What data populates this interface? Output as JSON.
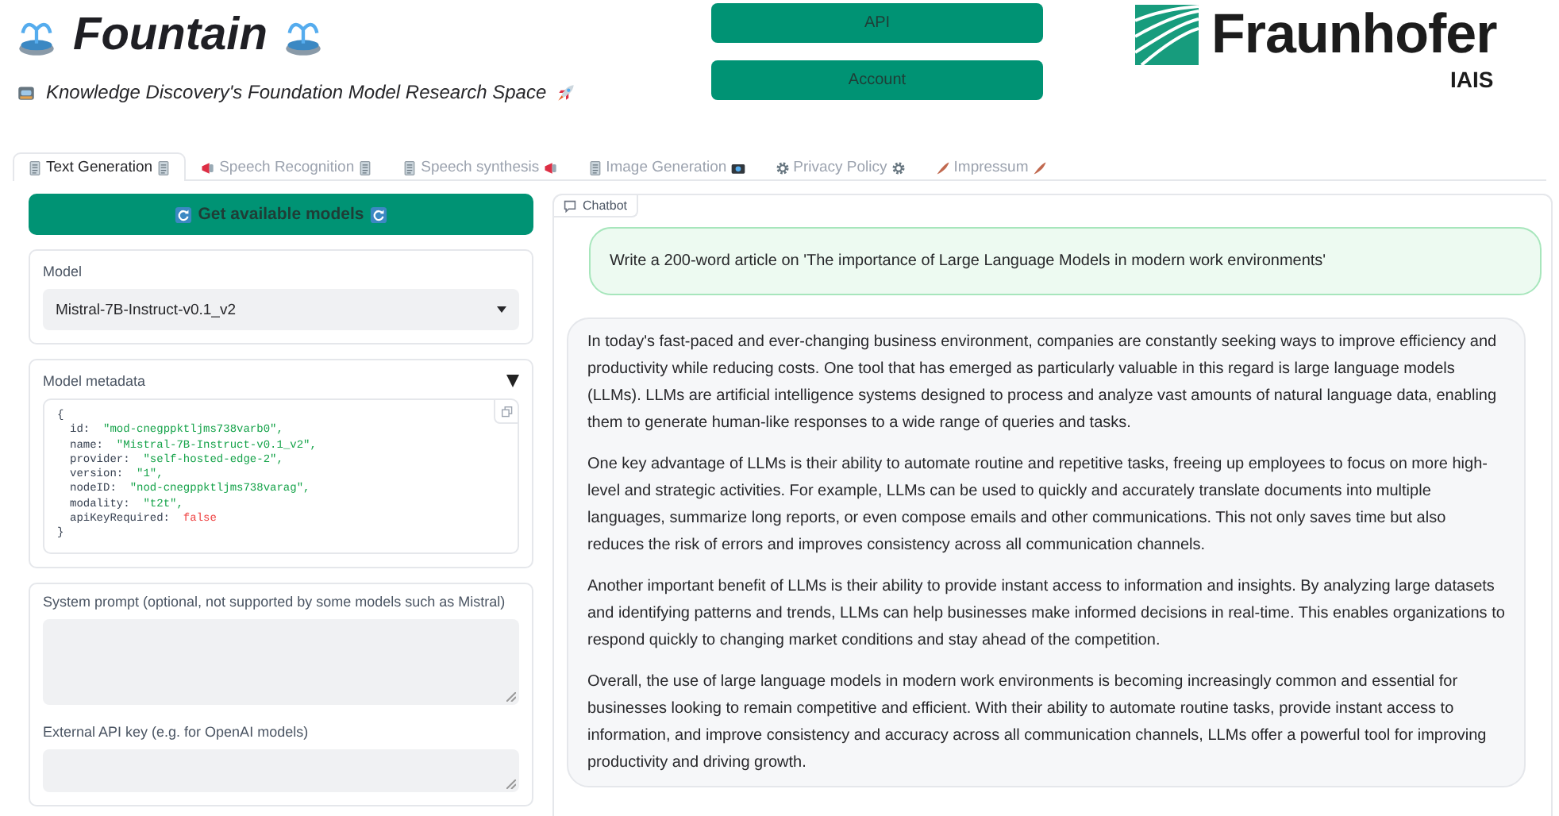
{
  "header": {
    "title": "Fountain",
    "subtitle": "Knowledge Discovery's Foundation Model Research Space",
    "buttons": [
      "API",
      "Account"
    ],
    "logo": {
      "name": "Fraunhofer",
      "sub": "IAIS"
    }
  },
  "tabs": [
    {
      "label": "Text Generation",
      "selected": true
    },
    {
      "label": "Speech Recognition",
      "selected": false
    },
    {
      "label": "Speech synthesis",
      "selected": false
    },
    {
      "label": "Image Generation",
      "selected": false
    },
    {
      "label": "Privacy Policy",
      "selected": false
    },
    {
      "label": "Impressum",
      "selected": false
    }
  ],
  "controls": {
    "get_models_button": "Get available models",
    "model": {
      "label": "Model",
      "value": "Mistral-7B-Instruct-v0.1_v2"
    },
    "metadata": {
      "label": "Model metadata",
      "expanded": true,
      "open": "{",
      "close": "}",
      "lines": [
        {
          "key": "id:",
          "value": "\"mod-cnegppktljms738varb0\",",
          "kind": "string"
        },
        {
          "key": "name:",
          "value": "\"Mistral-7B-Instruct-v0.1_v2\",",
          "kind": "string"
        },
        {
          "key": "provider:",
          "value": "\"self-hosted-edge-2\",",
          "kind": "string"
        },
        {
          "key": "version:",
          "value": "\"1\",",
          "kind": "string"
        },
        {
          "key": "nodeID:",
          "value": "\"nod-cnegppktljms738varag\",",
          "kind": "string"
        },
        {
          "key": "modality:",
          "value": "\"t2t\",",
          "kind": "string"
        },
        {
          "key": "apiKeyRequired:",
          "value": "false",
          "kind": "boolean"
        }
      ]
    },
    "system_prompt": {
      "label": "System prompt (optional, not supported by some models such as Mistral)"
    },
    "api_key": {
      "label": "External API key (e.g. for OpenAI models)"
    }
  },
  "chatbot": {
    "label": "Chatbot",
    "messages": [
      {
        "kind": "user",
        "paragraphs": [
          "Write a 200-word article on 'The importance of Large Language Models in modern work environments'"
        ]
      },
      {
        "kind": "bot",
        "paragraphs": [
          "In today's fast-paced and ever-changing business environment, companies are constantly seeking ways to improve efficiency and productivity while reducing costs. One tool that has emerged as particularly valuable in this regard is large language models (LLMs). LLMs are artificial intelligence systems designed to process and analyze vast amounts of natural language data, enabling them to generate human-like responses to a wide range of queries and tasks.",
          "One key advantage of LLMs is their ability to automate routine and repetitive tasks, freeing up employees to focus on more high-level and strategic activities. For example, LLMs can be used to quickly and accurately translate documents into multiple languages, summarize long reports, or even compose emails and other communications. This not only saves time but also reduces the risk of errors and improves consistency across all communication channels.",
          "Another important benefit of LLMs is their ability to provide instant access to information and insights. By analyzing large datasets and identifying patterns and trends, LLMs can help businesses make informed decisions in real-time. This enables organizations to respond quickly to changing market conditions and stay ahead of the competition.",
          "Overall, the use of large language models in modern work environments is becoming increasingly common and essential for businesses looking to remain competitive and efficient. With their ability to automate routine tasks, provide instant access to information, and improve consistency and accuracy across all communication channels, LLMs offer a powerful tool for improving productivity and driving growth."
        ]
      }
    ]
  }
}
